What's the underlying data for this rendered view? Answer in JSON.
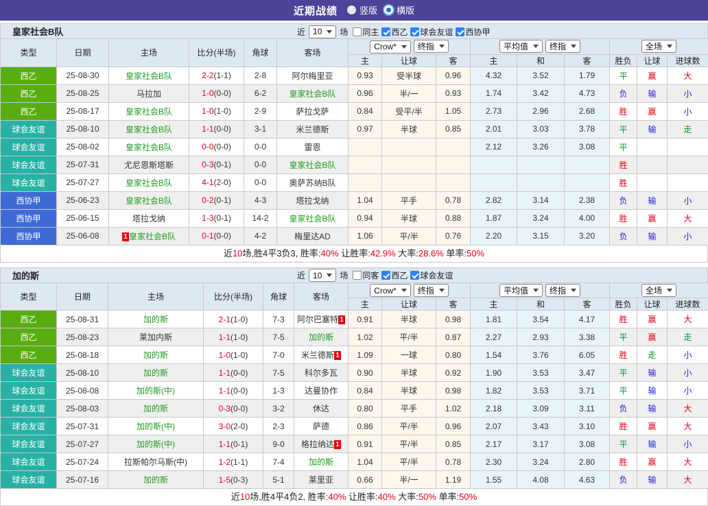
{
  "topbar": {
    "title": "近期战绩",
    "view_options": [
      {
        "label": "竖版",
        "selected": false
      },
      {
        "label": "横版",
        "selected": true
      }
    ]
  },
  "colors": {
    "topbar_bg": "#4d4399",
    "league": {
      "西乙": "#5aad11",
      "球会友谊": "#27b1a5",
      "西协甲": "#3d6bd5"
    },
    "focus_team": "#1e9c1e",
    "normal_team": "#333333",
    "score_red": "#e60012",
    "result": {
      "red": "#e60012",
      "green": "#009933",
      "blue": "#2424d8"
    },
    "odds_bg": "#fdf7ed",
    "avg_bg": "#e9f4f9",
    "header_bg": "#dde8f3",
    "checkbox_blue": "#2f81f7"
  },
  "table_columns": {
    "main": [
      "类型",
      "日期",
      "主场",
      "比分(半场)",
      "角球",
      "客场"
    ],
    "sub": [
      "主",
      "让球",
      "客",
      "主",
      "和",
      "客",
      "胜负",
      "让球",
      "进球数"
    ],
    "selects": [
      "Crow*",
      "终指",
      "平均值",
      "终指",
      "全场"
    ]
  },
  "tables": [
    {
      "team": "皇家社会B队",
      "filters": {
        "prefix": "近",
        "count": "10",
        "suffix": "场",
        "checkboxes": [
          {
            "label": "同主",
            "checked": false
          },
          {
            "label": "西乙",
            "checked": true
          },
          {
            "label": "球会友谊",
            "checked": true
          },
          {
            "label": "西协甲",
            "checked": true
          }
        ]
      },
      "rows": [
        {
          "league": "西乙",
          "date": "25-08-30",
          "home": "皇家社会B队",
          "home_focus": true,
          "home_red_card": false,
          "score": "2-2",
          "half": "(1-1)",
          "corners": "2-8",
          "away": "阿尔梅里亚",
          "away_focus": false,
          "away_red_card": false,
          "odds": [
            "0.93",
            "受半球",
            "0.96"
          ],
          "avg": [
            "4.32",
            "3.52",
            "1.79"
          ],
          "results": [
            {
              "text": "平",
              "color": "green"
            },
            {
              "text": "赢",
              "color": "red"
            },
            {
              "text": "大",
              "color": "red"
            }
          ]
        },
        {
          "league": "西乙",
          "date": "25-08-25",
          "home": "马拉加",
          "home_focus": false,
          "home_red_card": false,
          "score": "1-0",
          "half": "(0-0)",
          "corners": "6-2",
          "away": "皇家社会B队",
          "away_focus": true,
          "away_red_card": false,
          "odds": [
            "0.96",
            "半/一",
            "0.93"
          ],
          "avg": [
            "1.74",
            "3.42",
            "4.73"
          ],
          "results": [
            {
              "text": "负",
              "color": "blue"
            },
            {
              "text": "输",
              "color": "blue"
            },
            {
              "text": "小",
              "color": "blue"
            }
          ]
        },
        {
          "league": "西乙",
          "date": "25-08-17",
          "home": "皇家社会B队",
          "home_focus": true,
          "home_red_card": false,
          "score": "1-0",
          "half": "(1-0)",
          "corners": "2-9",
          "away": "萨拉戈萨",
          "away_focus": false,
          "away_red_card": false,
          "odds": [
            "0.84",
            "受平/半",
            "1.05"
          ],
          "avg": [
            "2.73",
            "2.96",
            "2.68"
          ],
          "results": [
            {
              "text": "胜",
              "color": "red"
            },
            {
              "text": "赢",
              "color": "red"
            },
            {
              "text": "小",
              "color": "blue"
            }
          ]
        },
        {
          "league": "球会友谊",
          "date": "25-08-10",
          "home": "皇家社会B队",
          "home_focus": true,
          "home_red_card": false,
          "score": "1-1",
          "half": "(0-0)",
          "corners": "3-1",
          "away": "米兰德斯",
          "away_focus": false,
          "away_red_card": false,
          "odds": [
            "0.97",
            "半球",
            "0.85"
          ],
          "avg": [
            "2.01",
            "3.03",
            "3.78"
          ],
          "results": [
            {
              "text": "平",
              "color": "green"
            },
            {
              "text": "输",
              "color": "blue"
            },
            {
              "text": "走",
              "color": "green"
            }
          ]
        },
        {
          "league": "球会友谊",
          "date": "25-08-02",
          "home": "皇家社会B队",
          "home_focus": true,
          "home_red_card": false,
          "score": "0-0",
          "half": "(0-0)",
          "corners": "0-0",
          "away": "雷恩",
          "away_focus": false,
          "away_red_card": false,
          "odds": [
            "",
            "",
            ""
          ],
          "avg": [
            "2.12",
            "3.26",
            "3.08"
          ],
          "results": [
            {
              "text": "平",
              "color": "green"
            },
            {
              "text": "",
              "color": ""
            },
            {
              "text": "",
              "color": ""
            }
          ]
        },
        {
          "league": "球会友谊",
          "date": "25-07-31",
          "home": "尤尼恩斯塔斯",
          "home_focus": false,
          "home_red_card": false,
          "score": "0-3",
          "half": "(0-1)",
          "corners": "0-0",
          "away": "皇家社会B队",
          "away_focus": true,
          "away_red_card": false,
          "odds": [
            "",
            "",
            ""
          ],
          "avg": [
            "",
            "",
            ""
          ],
          "results": [
            {
              "text": "胜",
              "color": "red"
            },
            {
              "text": "",
              "color": ""
            },
            {
              "text": "",
              "color": ""
            }
          ]
        },
        {
          "league": "球会友谊",
          "date": "25-07-27",
          "home": "皇家社会B队",
          "home_focus": true,
          "home_red_card": false,
          "score": "4-1",
          "half": "(2-0)",
          "corners": "0-0",
          "away": "奥萨苏纳B队",
          "away_focus": false,
          "away_red_card": false,
          "odds": [
            "",
            "",
            ""
          ],
          "avg": [
            "",
            "",
            ""
          ],
          "results": [
            {
              "text": "胜",
              "color": "red"
            },
            {
              "text": "",
              "color": ""
            },
            {
              "text": "",
              "color": ""
            }
          ]
        },
        {
          "league": "西协甲",
          "date": "25-06-23",
          "home": "皇家社会B队",
          "home_focus": true,
          "home_red_card": false,
          "score": "0-2",
          "half": "(0-1)",
          "corners": "4-3",
          "away": "塔拉戈纳",
          "away_focus": false,
          "away_red_card": false,
          "odds": [
            "1.04",
            "平手",
            "0.78"
          ],
          "avg": [
            "2.82",
            "3.14",
            "2.38"
          ],
          "results": [
            {
              "text": "负",
              "color": "blue"
            },
            {
              "text": "输",
              "color": "blue"
            },
            {
              "text": "小",
              "color": "blue"
            }
          ]
        },
        {
          "league": "西协甲",
          "date": "25-06-15",
          "home": "塔拉戈纳",
          "home_focus": false,
          "home_red_card": false,
          "score": "1-3",
          "half": "(0-1)",
          "corners": "14-2",
          "away": "皇家社会B队",
          "away_focus": true,
          "away_red_card": false,
          "odds": [
            "0.94",
            "半球",
            "0.88"
          ],
          "avg": [
            "1.87",
            "3.24",
            "4.00"
          ],
          "results": [
            {
              "text": "胜",
              "color": "red"
            },
            {
              "text": "赢",
              "color": "red"
            },
            {
              "text": "大",
              "color": "red"
            }
          ]
        },
        {
          "league": "西协甲",
          "date": "25-06-08",
          "home": "皇家社会B队",
          "home_focus": true,
          "home_red_card": true,
          "score": "0-1",
          "half": "(0-0)",
          "corners": "4-2",
          "away": "梅里达AD",
          "away_focus": false,
          "away_red_card": false,
          "odds": [
            "1.06",
            "平/半",
            "0.76"
          ],
          "avg": [
            "2.20",
            "3.15",
            "3.20"
          ],
          "results": [
            {
              "text": "负",
              "color": "blue"
            },
            {
              "text": "输",
              "color": "blue"
            },
            {
              "text": "小",
              "color": "blue"
            }
          ]
        }
      ],
      "summary": [
        {
          "text": "近",
          "red": false
        },
        {
          "text": "10",
          "red": true
        },
        {
          "text": "场,胜4平3负3, 胜率:",
          "red": false
        },
        {
          "text": "40%",
          "red": true
        },
        {
          "text": " 让胜率:",
          "red": false
        },
        {
          "text": "42.9%",
          "red": true
        },
        {
          "text": " 大率:",
          "red": false
        },
        {
          "text": "28.6%",
          "red": true
        },
        {
          "text": " 单率:",
          "red": false
        },
        {
          "text": "50%",
          "red": true
        }
      ]
    },
    {
      "team": "加的斯",
      "filters": {
        "prefix": "近",
        "count": "10",
        "suffix": "场",
        "checkboxes": [
          {
            "label": "同客",
            "checked": false
          },
          {
            "label": "西乙",
            "checked": true
          },
          {
            "label": "球会友谊",
            "checked": true
          }
        ]
      },
      "rows": [
        {
          "league": "西乙",
          "date": "25-08-31",
          "home": "加的斯",
          "home_focus": true,
          "home_red_card": false,
          "score": "2-1",
          "half": "(1-0)",
          "corners": "7-3",
          "away": "阿尔巴塞特",
          "away_focus": false,
          "away_red_card": true,
          "odds": [
            "0.91",
            "半球",
            "0.98"
          ],
          "avg": [
            "1.81",
            "3.54",
            "4.17"
          ],
          "results": [
            {
              "text": "胜",
              "color": "red"
            },
            {
              "text": "赢",
              "color": "red"
            },
            {
              "text": "大",
              "color": "red"
            }
          ]
        },
        {
          "league": "西乙",
          "date": "25-08-23",
          "home": "莱加内斯",
          "home_focus": false,
          "home_red_card": false,
          "score": "1-1",
          "half": "(1-0)",
          "corners": "7-5",
          "away": "加的斯",
          "away_focus": true,
          "away_red_card": false,
          "odds": [
            "1.02",
            "平/半",
            "0.87"
          ],
          "avg": [
            "2.27",
            "2.93",
            "3.38"
          ],
          "results": [
            {
              "text": "平",
              "color": "green"
            },
            {
              "text": "赢",
              "color": "red"
            },
            {
              "text": "走",
              "color": "green"
            }
          ]
        },
        {
          "league": "西乙",
          "date": "25-08-18",
          "home": "加的斯",
          "home_focus": true,
          "home_red_card": false,
          "score": "1-0",
          "half": "(1-0)",
          "corners": "7-0",
          "away": "米兰德斯",
          "away_focus": false,
          "away_red_card": true,
          "odds": [
            "1.09",
            "一球",
            "0.80"
          ],
          "avg": [
            "1.54",
            "3.76",
            "6.05"
          ],
          "results": [
            {
              "text": "胜",
              "color": "red"
            },
            {
              "text": "走",
              "color": "green"
            },
            {
              "text": "小",
              "color": "blue"
            }
          ]
        },
        {
          "league": "球会友谊",
          "date": "25-08-10",
          "home": "加的斯",
          "home_focus": true,
          "home_red_card": false,
          "score": "1-1",
          "half": "(0-0)",
          "corners": "7-5",
          "away": "科尔多瓦",
          "away_focus": false,
          "away_red_card": false,
          "odds": [
            "0.90",
            "半球",
            "0.92"
          ],
          "avg": [
            "1.90",
            "3.53",
            "3.47"
          ],
          "results": [
            {
              "text": "平",
              "color": "green"
            },
            {
              "text": "输",
              "color": "blue"
            },
            {
              "text": "小",
              "color": "blue"
            }
          ]
        },
        {
          "league": "球会友谊",
          "date": "25-08-08",
          "home": "加的斯(中)",
          "home_focus": true,
          "home_red_card": false,
          "score": "1-1",
          "half": "(0-0)",
          "corners": "1-3",
          "away": "达曼协作",
          "away_focus": false,
          "away_red_card": false,
          "odds": [
            "0.84",
            "半球",
            "0.98"
          ],
          "avg": [
            "1.82",
            "3.53",
            "3.71"
          ],
          "results": [
            {
              "text": "平",
              "color": "green"
            },
            {
              "text": "输",
              "color": "blue"
            },
            {
              "text": "小",
              "color": "blue"
            }
          ]
        },
        {
          "league": "球会友谊",
          "date": "25-08-03",
          "home": "加的斯",
          "home_focus": true,
          "home_red_card": false,
          "score": "0-3",
          "half": "(0-0)",
          "corners": "3-2",
          "away": "休达",
          "away_focus": false,
          "away_red_card": false,
          "odds": [
            "0.80",
            "平手",
            "1.02"
          ],
          "avg": [
            "2.18",
            "3.09",
            "3.11"
          ],
          "results": [
            {
              "text": "负",
              "color": "blue"
            },
            {
              "text": "输",
              "color": "blue"
            },
            {
              "text": "大",
              "color": "red"
            }
          ]
        },
        {
          "league": "球会友谊",
          "date": "25-07-31",
          "home": "加的斯(中)",
          "home_focus": true,
          "home_red_card": false,
          "score": "3-0",
          "half": "(2-0)",
          "corners": "2-3",
          "away": "萨德",
          "away_focus": false,
          "away_red_card": false,
          "odds": [
            "0.86",
            "平/半",
            "0.96"
          ],
          "avg": [
            "2.07",
            "3.43",
            "3.10"
          ],
          "results": [
            {
              "text": "胜",
              "color": "red"
            },
            {
              "text": "赢",
              "color": "red"
            },
            {
              "text": "大",
              "color": "red"
            }
          ]
        },
        {
          "league": "球会友谊",
          "date": "25-07-27",
          "home": "加的斯(中)",
          "home_focus": true,
          "home_red_card": false,
          "score": "1-1",
          "half": "(0-1)",
          "corners": "9-0",
          "away": "格拉纳达",
          "away_focus": false,
          "away_red_card": true,
          "odds": [
            "0.91",
            "平/半",
            "0.85"
          ],
          "avg": [
            "2.17",
            "3.17",
            "3.08"
          ],
          "results": [
            {
              "text": "平",
              "color": "green"
            },
            {
              "text": "输",
              "color": "blue"
            },
            {
              "text": "小",
              "color": "blue"
            }
          ]
        },
        {
          "league": "球会友谊",
          "date": "25-07-24",
          "home": "拉斯帕尔马斯(中)",
          "home_focus": false,
          "home_red_card": false,
          "score": "1-2",
          "half": "(1-1)",
          "corners": "7-4",
          "away": "加的斯",
          "away_focus": true,
          "away_red_card": false,
          "odds": [
            "1.04",
            "平/半",
            "0.78"
          ],
          "avg": [
            "2.30",
            "3.24",
            "2.80"
          ],
          "results": [
            {
              "text": "胜",
              "color": "red"
            },
            {
              "text": "赢",
              "color": "red"
            },
            {
              "text": "大",
              "color": "red"
            }
          ]
        },
        {
          "league": "球会友谊",
          "date": "25-07-16",
          "home": "加的斯",
          "home_focus": true,
          "home_red_card": false,
          "score": "1-5",
          "half": "(0-3)",
          "corners": "5-1",
          "away": "莱里亚",
          "away_focus": false,
          "away_red_card": false,
          "odds": [
            "0.66",
            "半/一",
            "1.19"
          ],
          "avg": [
            "1.55",
            "4.08",
            "4.63"
          ],
          "results": [
            {
              "text": "负",
              "color": "blue"
            },
            {
              "text": "输",
              "color": "blue"
            },
            {
              "text": "大",
              "color": "red"
            }
          ]
        }
      ],
      "summary": [
        {
          "text": "近",
          "red": false
        },
        {
          "text": "10",
          "red": true
        },
        {
          "text": "场,胜4平4负2, 胜率:",
          "red": false
        },
        {
          "text": "40%",
          "red": true
        },
        {
          "text": " 让胜率:",
          "red": false
        },
        {
          "text": "40%",
          "red": true
        },
        {
          "text": " 大率:",
          "red": false
        },
        {
          "text": "50%",
          "red": true
        },
        {
          "text": " 单率:",
          "red": false
        },
        {
          "text": "50%",
          "red": true
        }
      ]
    }
  ]
}
